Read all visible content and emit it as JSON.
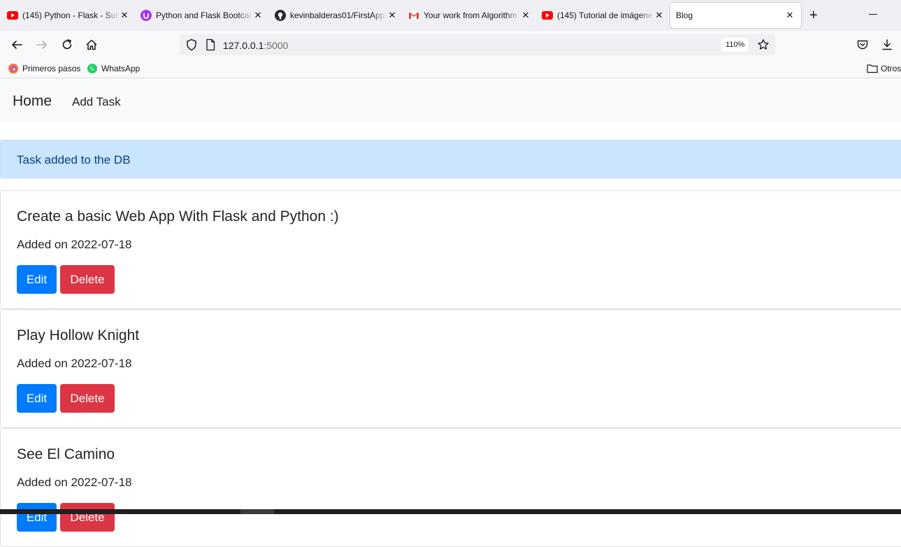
{
  "browser": {
    "tabs": [
      {
        "title": "(145) Python - Flask - Sub",
        "icon": "youtube-icon"
      },
      {
        "title": "Python and Flask Bootcam",
        "icon": "udemy-icon"
      },
      {
        "title": "kevinbalderas01/FirstApp",
        "icon": "github-icon"
      },
      {
        "title": "Your work from Algorithm",
        "icon": "gmail-icon"
      },
      {
        "title": "(145) Tutorial de imágene",
        "icon": "youtube-icon"
      },
      {
        "title": "Blog",
        "icon": "none"
      }
    ],
    "url_host": "127.0.0.1",
    "url_port": ":5000",
    "zoom": "110%",
    "bookmarks": [
      {
        "label": "Primeros pasos",
        "icon": "firefox-icon"
      },
      {
        "label": "WhatsApp",
        "icon": "whatsapp-icon"
      }
    ],
    "other_bookmarks": "Otros"
  },
  "site": {
    "brand": "Home",
    "nav_add": "Add Task",
    "alert": "Task added to the DB",
    "tasks": [
      {
        "title": "Create a basic Web App With Flask and Python :)",
        "date": "Added on 2022-07-18",
        "edit": "Edit",
        "delete": "Delete"
      },
      {
        "title": "Play Hollow Knight",
        "date": "Added on 2022-07-18",
        "edit": "Edit",
        "delete": "Delete"
      },
      {
        "title": "See El Camino",
        "date": "Added on 2022-07-18",
        "edit": "Edit",
        "delete": "Delete"
      }
    ]
  },
  "colors": {
    "primary": "#007bff",
    "danger": "#dc3545",
    "alert_bg": "#cce5ff",
    "alert_text": "#004085",
    "youtube": "#ff0000",
    "udemy": "#a435f0"
  }
}
